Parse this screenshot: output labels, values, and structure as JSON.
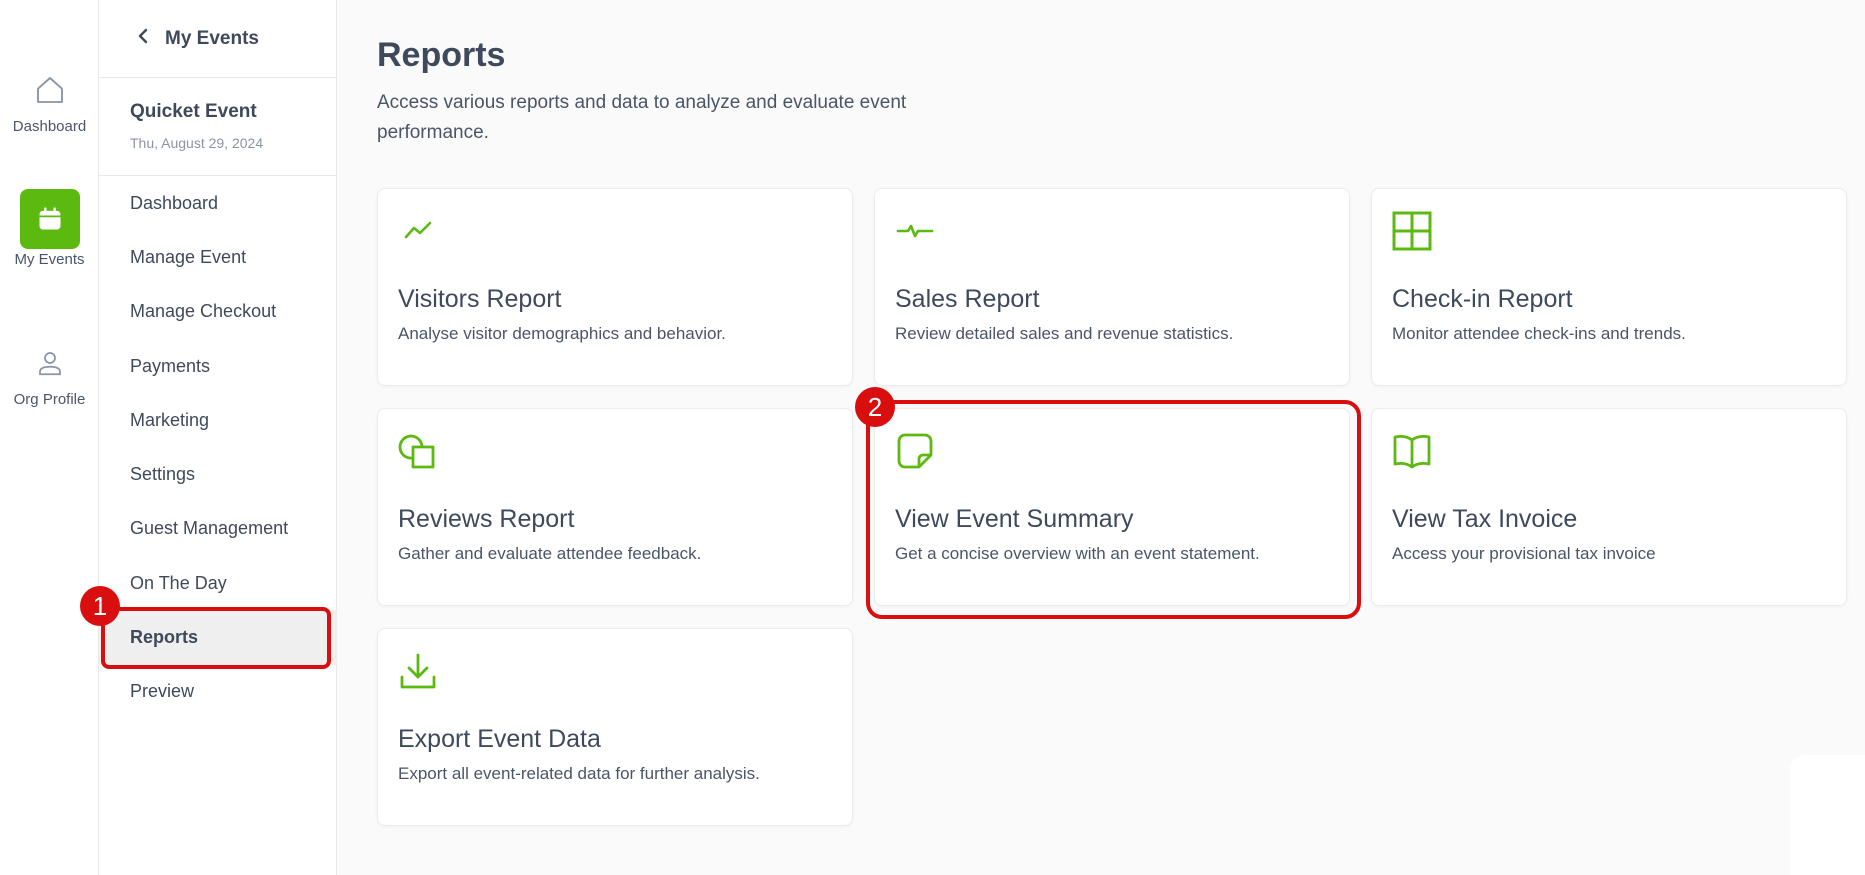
{
  "rail": {
    "items": [
      {
        "label": "Dashboard",
        "icon": "home-icon"
      },
      {
        "label": "My Events",
        "icon": "calendar-icon"
      },
      {
        "label": "Org Profile",
        "icon": "user-icon"
      }
    ]
  },
  "sidebar": {
    "back_label": "My Events",
    "event_name": "Quicket Event",
    "event_date": "Thu, August 29, 2024",
    "items": [
      {
        "label": "Dashboard"
      },
      {
        "label": "Manage Event"
      },
      {
        "label": "Manage Checkout"
      },
      {
        "label": "Payments"
      },
      {
        "label": "Marketing"
      },
      {
        "label": "Settings"
      },
      {
        "label": "Guest Management"
      },
      {
        "label": "On The Day"
      },
      {
        "label": "Reports"
      },
      {
        "label": "Preview"
      }
    ],
    "active_item": "Reports"
  },
  "main": {
    "title": "Reports",
    "description": "Access various reports and data to analyze and evaluate event performance.",
    "cards": [
      {
        "title": "Visitors Report",
        "description": "Analyse visitor demographics and behavior.",
        "icon": "trend-line-icon"
      },
      {
        "title": "Sales Report",
        "description": "Review detailed sales and revenue statistics.",
        "icon": "pulse-icon"
      },
      {
        "title": "Check-in Report",
        "description": "Monitor attendee check-ins and trends.",
        "icon": "grid-icon"
      },
      {
        "title": "Reviews Report",
        "description": "Gather and evaluate attendee feedback.",
        "icon": "shapes-icon"
      },
      {
        "title": "View Event Summary",
        "description": "Get a concise overview with an event statement.",
        "icon": "sticky-note-icon"
      },
      {
        "title": "View Tax Invoice",
        "description": "Access your provisional tax invoice",
        "icon": "book-open-icon"
      },
      {
        "title": "Export Event Data",
        "description": "Export all event-related data for further analysis.",
        "icon": "download-icon"
      }
    ]
  },
  "annotations": [
    {
      "number": "1",
      "target": "Reports"
    },
    {
      "number": "2",
      "target": "View Event Summary"
    }
  ],
  "colors": {
    "accent": "#5cb910",
    "annotation": "#d90f0f",
    "text": "#3e4a5c"
  }
}
